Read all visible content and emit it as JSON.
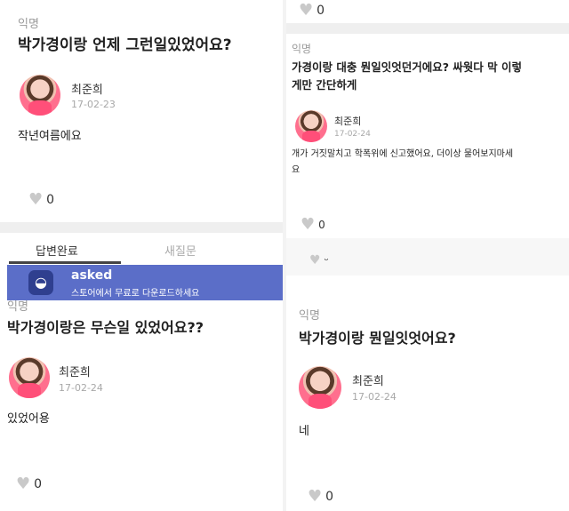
{
  "panels": {
    "top_left": {
      "anon": "익명",
      "question": "박가경이랑 언제 그런일있었어요?",
      "name": "최준희",
      "date": "17-02-23",
      "answer": "작년여름에요",
      "likes": "0"
    },
    "top_right": {
      "like_top": "0",
      "anon": "익명",
      "question_line1": "가경이랑 대충 뭔일잇엇던거에요? 싸웟다 막 이렇",
      "question_line2": "게만 간단하게",
      "name": "최준희",
      "date": "17-02-24",
      "answer_line1": "개가 거짓말치고 학폭위에 신고했어요, 더이상 물어보지마세",
      "answer_line2": "요",
      "likes": "0",
      "cut_like": "ᵕ"
    },
    "bottom_left": {
      "tab_answered": "답변완료",
      "tab_new": "새질문",
      "banner_app": "asked",
      "banner_sub": "스토어에서 무료로 다운로드하세요",
      "anon": "익명",
      "question": "박가경이랑은 무슨일 있었어요??",
      "name": "최준희",
      "date": "17-02-24",
      "answer": "있었어용",
      "likes": "0"
    },
    "bottom_right": {
      "anon": "익명",
      "question": "박가경이랑 뭔일잇엇어요?",
      "name": "최준희",
      "date": "17-02-24",
      "answer": "네",
      "likes": "0"
    }
  },
  "icons": {
    "heart": "♥",
    "app": "asked-logo-icon"
  },
  "colors": {
    "banner": "#5b6ec8",
    "heart": "#c9c9c9"
  }
}
